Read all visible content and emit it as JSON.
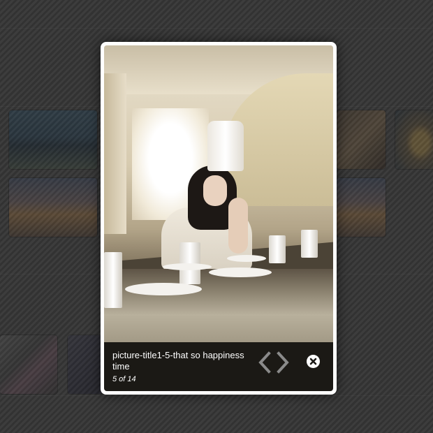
{
  "lightbox": {
    "caption_title": "picture-title1-5-that so happiness time",
    "counter": "5 of 14",
    "prev_icon": "chevron-left-icon",
    "next_icon": "chevron-right-icon",
    "close_icon": "close-icon",
    "colors": {
      "frame": "#ffffff",
      "caption_bg": "#1b1915",
      "nav_arrow": "#8a8a8a"
    }
  }
}
